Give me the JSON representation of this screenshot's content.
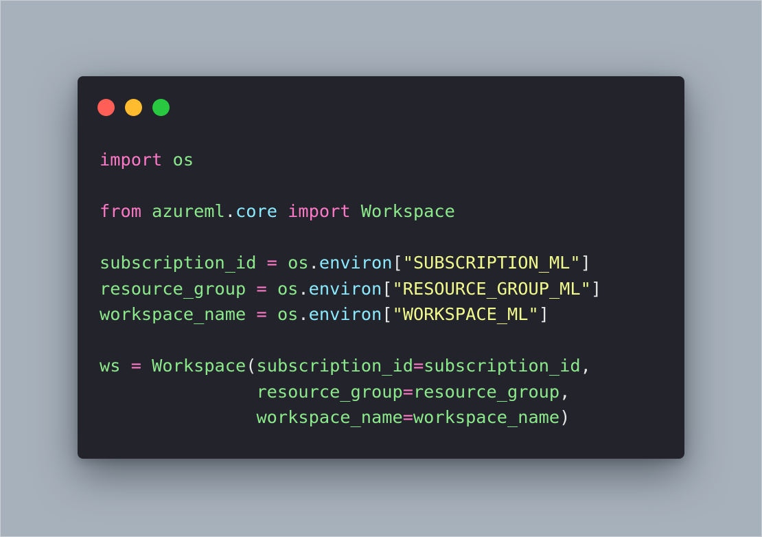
{
  "colors": {
    "background": "#a7b1bb",
    "window": "#23232b",
    "dot_close": "#ff5f57",
    "dot_minimize": "#febc2e",
    "dot_maximize": "#28c840",
    "keyword": "#ff79c6",
    "identifier": "#8be98b",
    "attribute": "#8be9fd",
    "string": "#f1fa8c",
    "punctuation": "#e6e6e6"
  },
  "window_controls": {
    "close": "close-dot",
    "minimize": "minimize-dot",
    "maximize": "maximize-dot"
  },
  "code": {
    "line1": {
      "kw_import": "import",
      "sp": " ",
      "mod": "os"
    },
    "line3": {
      "kw_from": "from",
      "sp1": " ",
      "pkg": "azureml",
      "dot": ".",
      "sub": "core",
      "sp2": " ",
      "kw_import": "import",
      "sp3": " ",
      "cls": "Workspace"
    },
    "line5": {
      "var": "subscription_id",
      "eq": " = ",
      "obj": "os",
      "dot": ".",
      "attr": "environ",
      "lb": "[",
      "str": "\"SUBSCRIPTION_ML\"",
      "rb": "]"
    },
    "line6": {
      "var": "resource_group",
      "eq": " = ",
      "obj": "os",
      "dot": ".",
      "attr": "environ",
      "lb": "[",
      "str": "\"RESOURCE_GROUP_ML\"",
      "rb": "]"
    },
    "line7": {
      "var": "workspace_name",
      "eq": " = ",
      "obj": "os",
      "dot": ".",
      "attr": "environ",
      "lb": "[",
      "str": "\"WORKSPACE_ML\"",
      "rb": "]"
    },
    "line9": {
      "var": "ws",
      "eq": " = ",
      "cls": "Workspace",
      "lp": "(",
      "kwarg": "subscription_id",
      "assign": "=",
      "val": "subscription_id",
      "comma": ","
    },
    "line10": {
      "indent": "               ",
      "kwarg": "resource_group",
      "assign": "=",
      "val": "resource_group",
      "comma": ","
    },
    "line11": {
      "indent": "               ",
      "kwarg": "workspace_name",
      "assign": "=",
      "val": "workspace_name",
      "rp": ")"
    }
  }
}
